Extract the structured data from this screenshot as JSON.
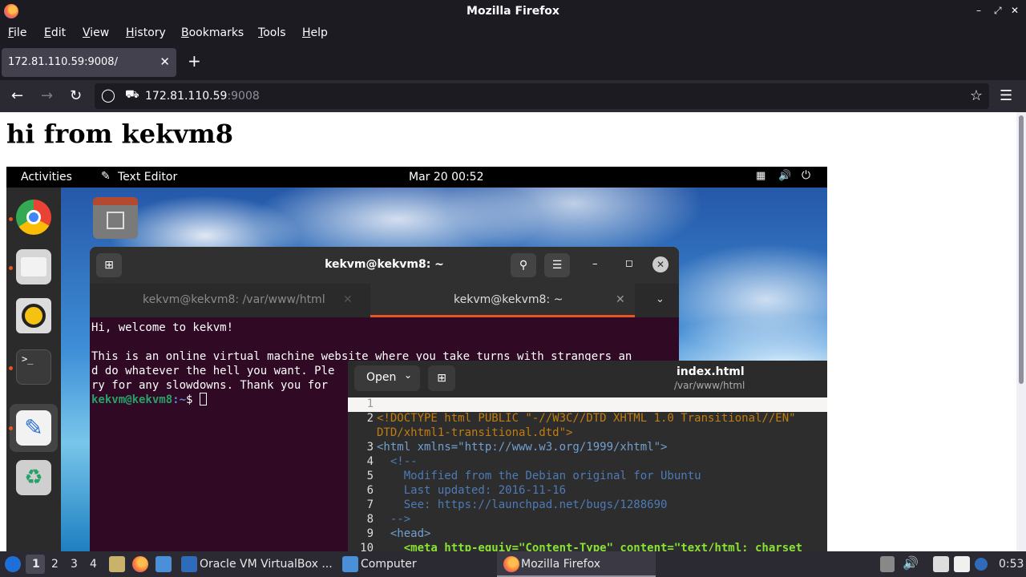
{
  "browser": {
    "window_title": "Mozilla Firefox",
    "menu": [
      "File",
      "Edit",
      "View",
      "History",
      "Bookmarks",
      "Tools",
      "Help"
    ],
    "tab_title": "172.81.110.59:9008/",
    "url_host": "172.81.110.59",
    "url_port": ":9008"
  },
  "page": {
    "heading": "hi from kekvm8"
  },
  "vm": {
    "activities": "Activities",
    "app_name": "Text Editor",
    "clock": "Mar 20  00:52",
    "terminal": {
      "title": "kekvm@kekvm8: ~",
      "tab1": "kekvm@kekvm8: /var/www/html",
      "tab2": "kekvm@kekvm8: ~",
      "line1": "Hi, welcome to kekvm!",
      "line2": "This is an online virtual machine website where you take turns with strangers an",
      "line3": "d do whatever the hell you want. Ple",
      "line4": "ry for any slowdowns. Thank you for",
      "prompt_user": "kekvm@kekvm8",
      "prompt_path": ":~",
      "prompt_sign": "$"
    },
    "editor": {
      "open_label": "Open",
      "filename": "index.html",
      "filepath": "/var/www/html",
      "lines": [
        {
          "n": "1",
          "t": ""
        },
        {
          "n": "2",
          "t": "<!DOCTYPE html PUBLIC \"-//W3C//DTD XHTML 1.0 Transitional//EN\""
        },
        {
          "n": "",
          "t": "DTD/xhtml1-transitional.dtd\">"
        },
        {
          "n": "3",
          "t": "<html xmlns=\"http://www.w3.org/1999/xhtml\">"
        },
        {
          "n": "4",
          "t": "  <!--"
        },
        {
          "n": "5",
          "t": "    Modified from the Debian original for Ubuntu"
        },
        {
          "n": "6",
          "t": "    Last updated: 2016-11-16"
        },
        {
          "n": "7",
          "t": "    See: https://launchpad.net/bugs/1288690"
        },
        {
          "n": "8",
          "t": "  -->"
        },
        {
          "n": "9",
          "t": "  <head>"
        },
        {
          "n": "10",
          "t": "    <meta http-equiv=\"Content-Type\" content=\"text/html; charset"
        }
      ]
    }
  },
  "taskbar": {
    "workspaces": [
      "1",
      "2",
      "3",
      "4"
    ],
    "task1": "Oracle VM VirtualBox ...",
    "task2": "Computer",
    "task3": "Mozilla Firefox",
    "time": "0:53"
  },
  "colors": {
    "firefox_dark": "#1c1b22",
    "terminal_bg": "#300a24",
    "ubuntu_orange": "#e95420"
  }
}
